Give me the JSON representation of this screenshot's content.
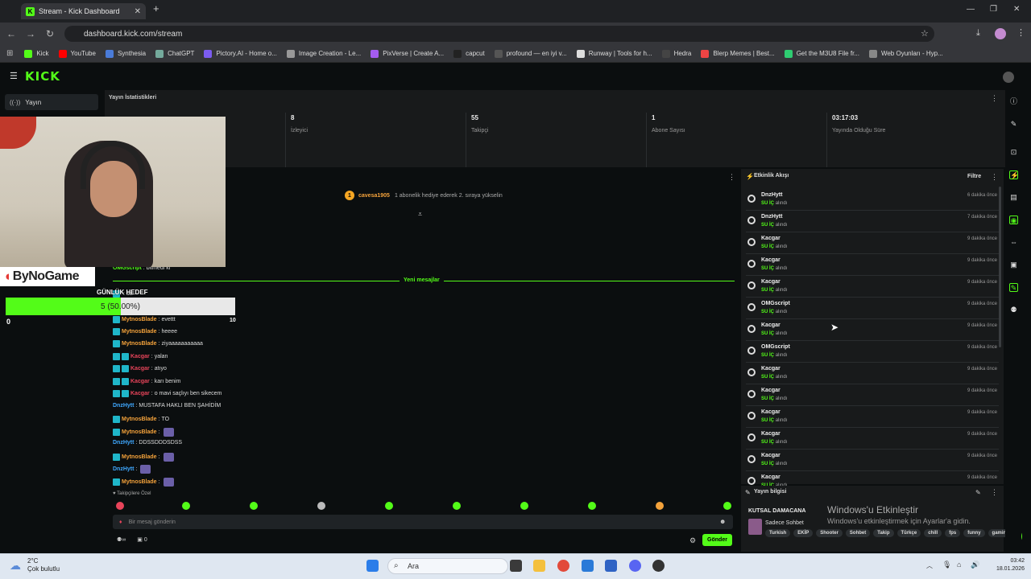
{
  "browser": {
    "tab_title": "Stream - Kick Dashboard",
    "url": "dashboard.kick.com/stream",
    "bookmarks": [
      "Kick",
      "YouTube",
      "Synthesia",
      "ChatGPT",
      "Pictory.AI - Home o...",
      "Image Creation - Le...",
      "PixVerse | Create A...",
      "capcut",
      "profound — en iyi v...",
      "Runway | Tools for h...",
      "Hedra",
      "Blerp Memes | Best...",
      "Get the M3U8 File fr...",
      "Web Oyunları - Hyp..."
    ]
  },
  "kick": {
    "logo": "KICK",
    "sidebar_item": "Yayın"
  },
  "stats": {
    "title": "Yayın İstatistikleri",
    "items": [
      {
        "value": "8",
        "label": "İzleyici"
      },
      {
        "value": "55",
        "label": "Takipçi"
      },
      {
        "value": "1",
        "label": "Abone Sayısı"
      },
      {
        "value": "03:17:03",
        "label": "Yayında Olduğu Süre"
      }
    ]
  },
  "overlay": {
    "brand": "ByNoGame",
    "goal_label": "GÜNLÜK HEDEF",
    "goal_text": "5 (50.00%)",
    "goal_fraction": 0.5,
    "goal_min": "0",
    "goal_max": "10"
  },
  "chat": {
    "pinned_user": "cavesa1905",
    "pinned_text": "1 abonelik hediye ederek 2. sıraya yükselin",
    "new_messages": "Yeni mesajlar",
    "lines": [
      {
        "user": "OMGscript",
        "cls": "cu-omg",
        "text": "bitmedi ki"
      },
      {
        "user": "",
        "cls": "cu-myt",
        "text": "sa"
      },
      {
        "user": "MytnosBlade",
        "cls": "cu-myt",
        "text": "evettt"
      },
      {
        "user": "MytnosBlade",
        "cls": "cu-myt",
        "text": "heeee"
      },
      {
        "user": "MytnosBlade",
        "cls": "cu-myt",
        "text": "ziyaaaaaaaaaaa"
      },
      {
        "user": "Kacgar",
        "cls": "cu-kac",
        "text": "yalan"
      },
      {
        "user": "Kacgar",
        "cls": "cu-kac",
        "text": "atıyo"
      },
      {
        "user": "Kacgar",
        "cls": "cu-kac",
        "text": "karı benim"
      },
      {
        "user": "Kacgar",
        "cls": "cu-kac",
        "text": "o mavi saçlıyı ben sikecem"
      },
      {
        "user": "DnzHytt",
        "cls": "cu-dnz",
        "text": "MUSTAFA HAKLI BEN ŞAHİDİM"
      },
      {
        "user": "MytnosBlade",
        "cls": "cu-myt",
        "text": "TO"
      },
      {
        "user": "MytnosBlade",
        "cls": "cu-myt",
        "text": ""
      },
      {
        "user": "DnzHytt",
        "cls": "cu-dnz",
        "text": "DDSSDDDSDSS"
      },
      {
        "user": "MytnosBlade",
        "cls": "cu-myt",
        "text": ""
      },
      {
        "user": "DnzHytt",
        "cls": "cu-dnz",
        "text": ""
      },
      {
        "user": "MytnosBlade",
        "cls": "cu-myt",
        "text": ""
      }
    ],
    "followers_only": "Takipçilere Özel",
    "input_placeholder": "Bir mesaj gönderin",
    "send": "Gönder",
    "footer_count": "0"
  },
  "activity": {
    "title": "Etkinlik Akışı",
    "filter": "Filtre",
    "action": "SU İÇ",
    "action_suffix": "alındı",
    "items": [
      {
        "name": "DnzHytt",
        "time": "6 dakika önce"
      },
      {
        "name": "DnzHytt",
        "time": "7 dakika önce"
      },
      {
        "name": "Kacgar",
        "time": "9 dakika önce"
      },
      {
        "name": "Kacgar",
        "time": "9 dakika önce"
      },
      {
        "name": "Kacgar",
        "time": "9 dakika önce"
      },
      {
        "name": "OMGscript",
        "time": "9 dakika önce"
      },
      {
        "name": "Kacgar",
        "time": "9 dakika önce"
      },
      {
        "name": "OMGscript",
        "time": "9 dakika önce"
      },
      {
        "name": "Kacgar",
        "time": "9 dakika önce"
      },
      {
        "name": "Kacgar",
        "time": "9 dakika önce"
      },
      {
        "name": "Kacgar",
        "time": "9 dakika önce"
      },
      {
        "name": "Kacgar",
        "time": "9 dakika önce"
      },
      {
        "name": "Kacgar",
        "time": "9 dakika önce"
      },
      {
        "name": "Kacgar",
        "time": "9 dakika önce"
      }
    ]
  },
  "stream_info": {
    "title": "Yayın bilgisi",
    "name": "KUTSAL DAMACANA",
    "category": "Sadece Sohbet",
    "tags": [
      "Turkish",
      "EKİP",
      "Shooter",
      "Sohbet",
      "Takip",
      "Türkçe",
      "chill",
      "fps",
      "funny",
      "gaming"
    ]
  },
  "windows": {
    "activate_title": "Windows'u Etkinleştir",
    "activate_sub": "Windows'u etkinleştirmek için Ayarlar'a gidin.",
    "weather_temp": "2°C",
    "weather_desc": "Çok bulutlu",
    "search": "Ara",
    "time": "03:42",
    "date": "18.01.2026"
  }
}
